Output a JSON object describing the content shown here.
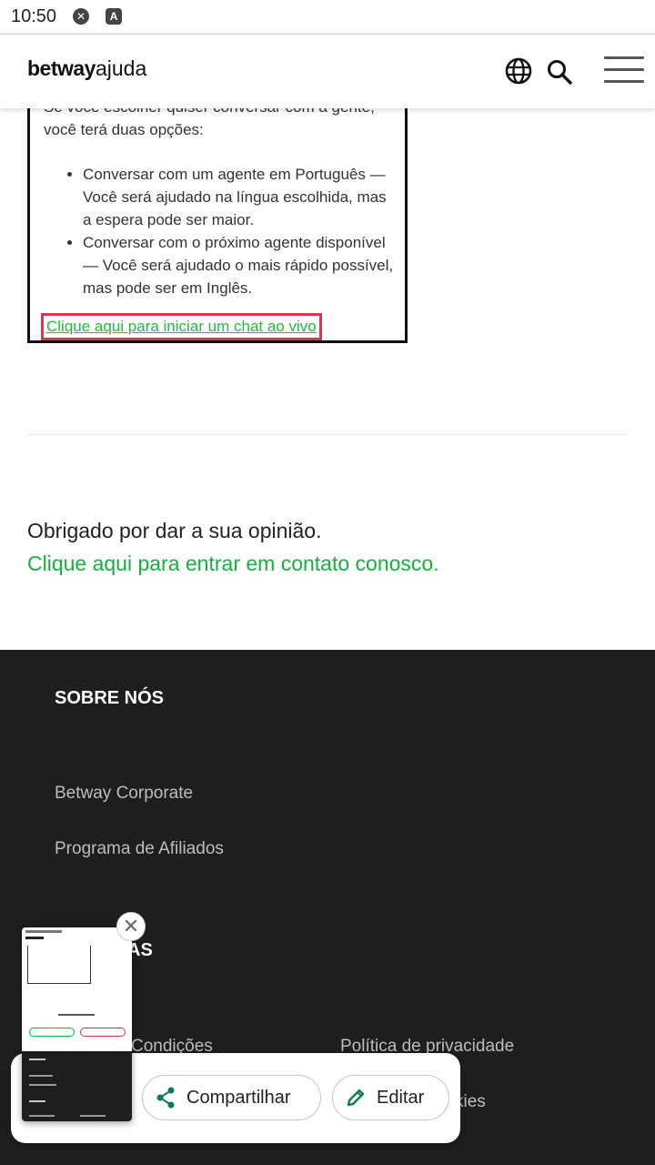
{
  "status_bar": {
    "time": "10:50",
    "icons": [
      "shield-x-icon",
      "a-box-icon"
    ]
  },
  "header": {
    "logo_brand": "betway",
    "logo_suffix": "ajuda",
    "icons": [
      "globe-icon",
      "search-icon",
      "hamburger-menu-icon"
    ]
  },
  "article_image": {
    "intro": "Se você escolher quiser conversar com a gente, você terá duas opções:",
    "bullets": [
      "Conversar com um agente em Português — Você será ajudado na língua escolhida, mas a espera pode ser maior.",
      "Conversar com o próximo agente disponível — Você será ajudado o mais rápido possível, mas pode ser em Inglês."
    ],
    "chat_link": "Clique aqui para iniciar um chat ao vivo",
    "highlight_color": "#e0344b"
  },
  "feedback": {
    "thanks": "Obrigado por dar a sua opinião.",
    "contact_link": "Clique aqui para entrar em contato conosco."
  },
  "footer": {
    "about_heading": "SOBRE NÓS",
    "about_links": [
      "Betway Corporate",
      "Programa de Afiliados"
    ],
    "policies_heading_partial": "AS",
    "policies_links": [
      "Condições",
      "Política de privacidade",
      "kies"
    ]
  },
  "share_sheet": {
    "share_label": "Compartilhar",
    "edit_label": "Editar",
    "close_icon": "close-icon"
  },
  "colors": {
    "accent_green": "#12b23c",
    "footer_bg": "#1e1e1e"
  }
}
